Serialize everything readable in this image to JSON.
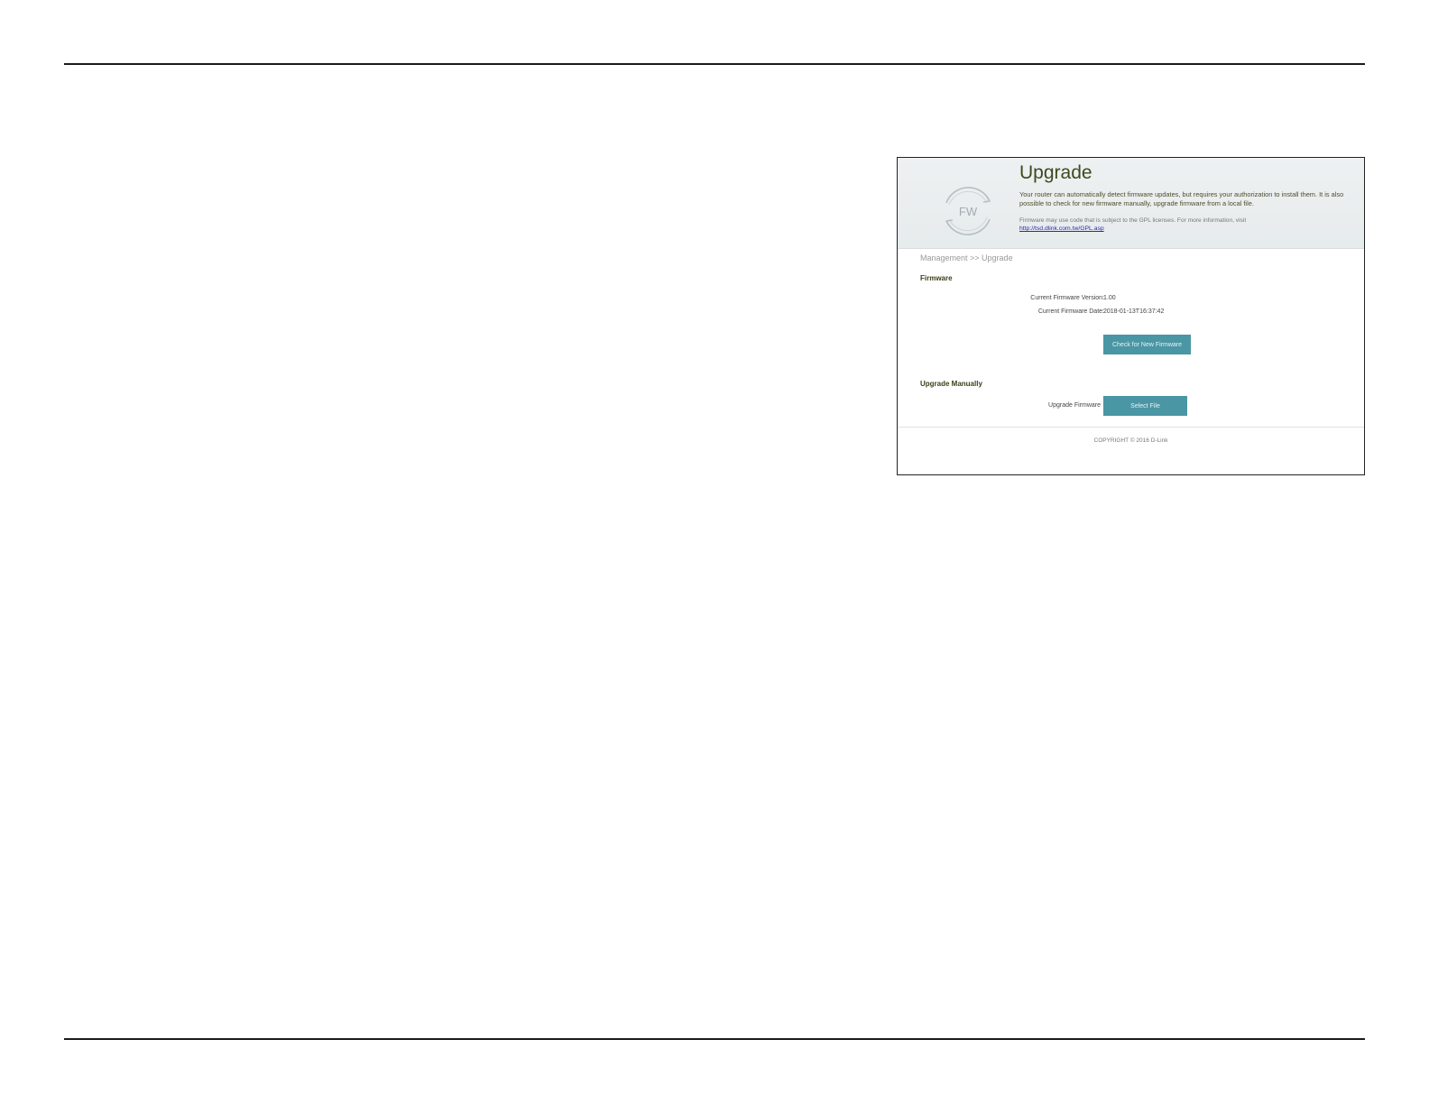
{
  "page": {
    "title": "Upgrade",
    "description": "Your router can automatically detect firmware updates, but requires your authorization to install them. It is also possible to check for new firmware manually, upgrade firmware from a local file.",
    "gpl_note": "Firmware may use code that is subject to the GPL licenses. For more information, visit",
    "gpl_link": "http://tsd.dlink.com.tw/GPL.asp",
    "icon_text": "FW",
    "icon": "fw-refresh-icon"
  },
  "breadcrumb": "Management >> Upgrade",
  "firmware": {
    "section_title": "Firmware",
    "version_label": "Current Firmware Version:",
    "version_value": "1.00",
    "date_label": "Current Firmware Date:",
    "date_value": "2018-01-13T16:37:42",
    "check_button": "Check for New Firmware"
  },
  "manual": {
    "section_title": "Upgrade Manually",
    "upgrade_label": "Upgrade Firmware",
    "select_button": "Select File"
  },
  "footer": {
    "copyright": "COPYRIGHT © 2016 D-Link"
  },
  "colors": {
    "button": "#4a96a4",
    "title": "#3d4a1f",
    "link": "#2a2aa8"
  }
}
